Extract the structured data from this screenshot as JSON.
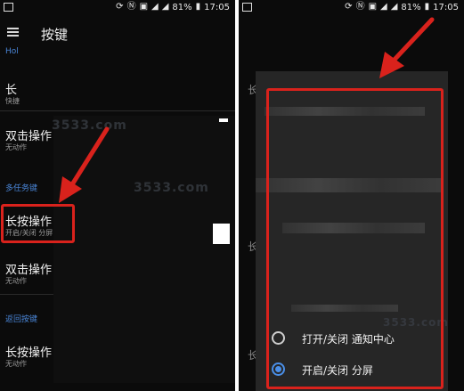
{
  "status_bar": {
    "battery": "81%",
    "time": "17:05",
    "icons": [
      "image-icon",
      "sync-icon",
      "nfc-icon",
      "no-sim-icon",
      "signal-icon",
      "signal-icon",
      "battery-icon"
    ]
  },
  "app_bar": {
    "title": "按键"
  },
  "sections": {
    "first_partial": "Hol",
    "multitask": "多任务键",
    "back": "返回按键"
  },
  "items": [
    {
      "title": "长",
      "subtitle": "快捷"
    },
    {
      "title": "双击操作",
      "subtitle": "无动作"
    },
    {
      "title": "长按操作",
      "subtitle": "开启/关闭 分屏"
    },
    {
      "title": "双击操作",
      "subtitle": "无动作"
    },
    {
      "title": "长按操作",
      "subtitle": "无动作"
    }
  ],
  "dialog": {
    "partial_labels": [
      "长",
      "长",
      "长"
    ],
    "options": [
      {
        "label": "打开/关闭 通知中心",
        "selected": false
      },
      {
        "label": "开启/关闭 分屏",
        "selected": true
      }
    ]
  },
  "watermark": {
    "text": "3533.com"
  },
  "colors": {
    "accent": "#4a86d8",
    "annotation": "#d9221c",
    "background": "#0b0b0b"
  }
}
